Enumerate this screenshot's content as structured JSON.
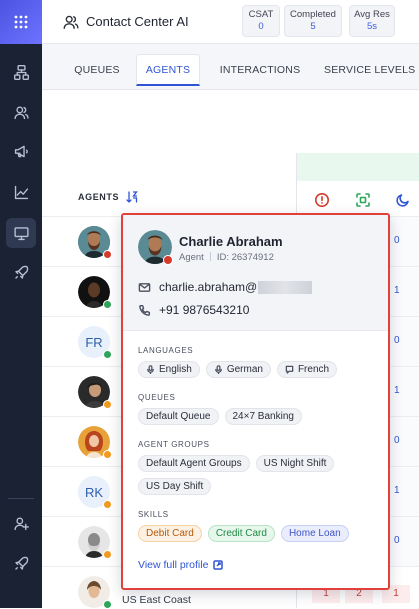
{
  "app": {
    "title": "Contact Center AI"
  },
  "metrics": [
    {
      "label": "CSAT",
      "value": "0"
    },
    {
      "label": "Completed",
      "value": "5"
    },
    {
      "label": "Avg Res",
      "value": "5s"
    }
  ],
  "tabs": [
    {
      "label": "QUEUES",
      "active": false
    },
    {
      "label": "AGENTS",
      "active": true
    },
    {
      "label": "INTERACTIONS",
      "active": false
    },
    {
      "label": "SERVICE LEVELS",
      "active": false
    }
  ],
  "sidebar": {
    "items": [
      {
        "icon": "hierarchy-icon"
      },
      {
        "icon": "users-icon"
      },
      {
        "icon": "megaphone-icon"
      },
      {
        "icon": "chart-line-icon"
      },
      {
        "icon": "monitor-icon",
        "active": true
      },
      {
        "icon": "rocket-icon"
      }
    ],
    "bottom_items": [
      {
        "icon": "add-user-icon"
      },
      {
        "icon": "rocket-icon"
      }
    ]
  },
  "agents_table": {
    "header": "AGENTS",
    "status_icons": [
      "alert-circle-icon",
      "scan-icon",
      "moon-icon"
    ],
    "rows": [
      {
        "initials": "",
        "status": "busy",
        "value": "0"
      },
      {
        "initials": "",
        "status": "available",
        "value": "1"
      },
      {
        "initials": "FR",
        "status": "available",
        "value": "0"
      },
      {
        "initials": "",
        "status": "away",
        "value": "1"
      },
      {
        "initials": "",
        "status": "away",
        "value": "0"
      },
      {
        "initials": "RK",
        "status": "away",
        "value": "1"
      },
      {
        "initials": "",
        "status": "away",
        "value": "0"
      },
      {
        "initials": "",
        "status": "available",
        "value": ""
      }
    ],
    "last_row_label": "US East Coast",
    "bottom_cells": [
      "1",
      "2",
      "1"
    ]
  },
  "popover": {
    "name": "Charlie Abraham",
    "role": "Agent",
    "id_text": "ID: 26374912",
    "email": "charlie.abraham@",
    "phone": "+91 9876543210",
    "languages_label": "LANGUAGES",
    "languages": [
      "English",
      "German",
      "French"
    ],
    "queues_label": "QUEUES",
    "queues": [
      "Default Queue",
      "24×7 Banking"
    ],
    "agent_groups_label": "AGENT GROUPS",
    "agent_groups": [
      "Default Agent Groups",
      "US Night Shift",
      "US Day Shift"
    ],
    "skills_label": "SKILLS",
    "skills": [
      {
        "label": "Debit Card",
        "tone": "orange"
      },
      {
        "label": "Credit Card",
        "tone": "green"
      },
      {
        "label": "Home Loan",
        "tone": "blue"
      }
    ],
    "profile_link": "View full profile"
  },
  "colors": {
    "accent": "#2f55d4",
    "highlight_border": "#e0413b",
    "busy": "#d33a2c",
    "available": "#2ea65a",
    "away": "#f29a1f"
  }
}
